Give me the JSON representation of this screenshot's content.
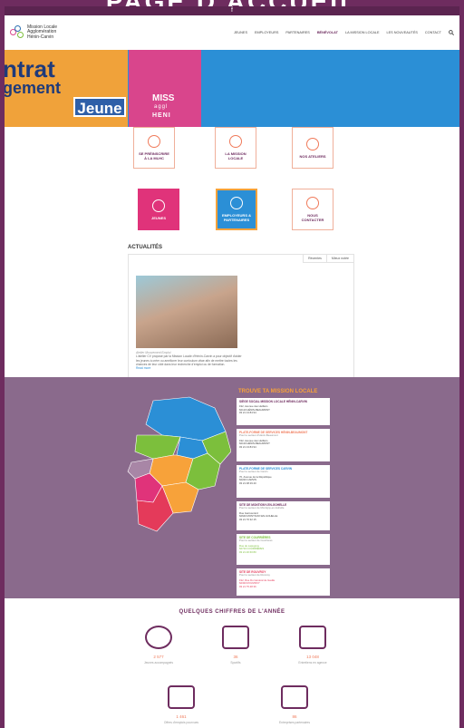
{
  "page_title": "PAGE D'ACCUEIL",
  "topbar": {
    "icon": "facebook-icon",
    "symbol": "f"
  },
  "logo": {
    "line1": "Mission Locale",
    "line2": "Agglomération",
    "line3": "Hénin-Carvin"
  },
  "nav": [
    "JEUNES",
    "EMPLOYEURS",
    "PARTENAIRES",
    "BÉNÉVOLAT",
    "LA MISSION LOCALE",
    "LES NOUVEAUTÉS",
    "CONTACT"
  ],
  "hero": {
    "word1": "ntrat",
    "word2": "gement",
    "word3": "Jeune",
    "brand1": "MISS",
    "brand2": "aggl",
    "brand3": "HENI"
  },
  "tiles": [
    {
      "label1": "SE PRÉINSCRIRE",
      "label2": "À LA MLHC"
    },
    {
      "label1": "LA MISSION",
      "label2": "LOCALE"
    },
    {
      "label1": "NOS ATELIERS",
      "label2": ""
    },
    {
      "label1": "JEUNES",
      "label2": ""
    },
    {
      "label1": "EMPLOYEURS &",
      "label2": "PARTENAIRES"
    },
    {
      "label1": "NOUS",
      "label2": "CONTACTER"
    }
  ],
  "actualites": {
    "title": "ACTUALITÉS",
    "tabs": [
      "Récentes",
      "Mieux notée"
    ],
    "caption": "Atelier Mouvement Emploi",
    "text": "L'atelier CV proposé par la Mission Locale d'Hénin-Carvin a pour objectif d'aider les jeunes à créer ou améliorer leur curriculum vitae afin de mettre toutes les chances de leur côté dans leur recherche d'emploi ou de formation.",
    "more": "Read more"
  },
  "map_section": {
    "title": "TROUVE TA MISSION LOCALE",
    "cards": [
      {
        "title": "SIÈGE SOCIAL MISSION LOCALE HÉNIN-CARVIN",
        "sub": "",
        "addr1": "192, Avenue des Huilliers",
        "addr2": "62110 HÉNIN-BEAUMONT",
        "tel": "03 21 13 84 94",
        "color": "#6e2c5f"
      },
      {
        "title": "PLATE-FORME DE SERVICES HÉNIN-BEAUMONT",
        "sub": "Pour le secteur d'Hénin-Beaumont",
        "addr1": "192, Avenue des Huilliers",
        "addr2": "62110 HÉNIN-BEAUMONT",
        "tel": "03 21 13 84 94",
        "color": "#f07a5a"
      },
      {
        "title": "PLATE-FORME DE SERVICES CARVIN",
        "sub": "Pour le secteur de Carvin",
        "addr1": "70, Avenue de la République",
        "addr2": "62220 CARVIN",
        "tel": "03 21 08 29 40",
        "color": "#2b8fd6"
      },
      {
        "title": "SITE DE MONTIGNY-EN-GOHELLE",
        "sub": "Pour le secteur de Montigny-en-Gohelle",
        "addr1": "Rue Garnouzard",
        "addr2": "62640 MONTIGNY-EN-GOHELLE",
        "tel": "03 21 76 32 15",
        "color": "#6e2c5f"
      },
      {
        "title": "SITE DE COURRIÈRES",
        "sub": "Pour le secteur de Courrières",
        "addr1": "Rue de Lapugnoy",
        "addr2": "62710 COURRIÈRES",
        "tel": "03 21 20 60 80",
        "color": "#7cbf3c"
      },
      {
        "title": "SITE DE ROUVROY",
        "sub": "Pour le secteur de Rouvroy",
        "addr1": "192, Rue Du Général de Gaulle",
        "addr2": "62320 ROUVROY",
        "tel": "03 21 75 48 36",
        "color": "#e43a5a"
      }
    ]
  },
  "stats": {
    "title": "QUELQUES CHIFFRES DE L'ANNÉE",
    "items": [
      {
        "num": "2 577",
        "label": "Jeunes accompagnés",
        "icon": "person-icon"
      },
      {
        "num": "36",
        "label": "Sportifs",
        "icon": "briefcase-icon"
      },
      {
        "num": "13 048",
        "label": "Entretiens en agence",
        "icon": "meeting-icon"
      },
      {
        "num": "1 461",
        "label": "Offres d'emplois pourvues",
        "icon": "newspaper-icon"
      },
      {
        "num": "86",
        "label": "Entreprises partenaires",
        "icon": "building-icon"
      }
    ]
  }
}
